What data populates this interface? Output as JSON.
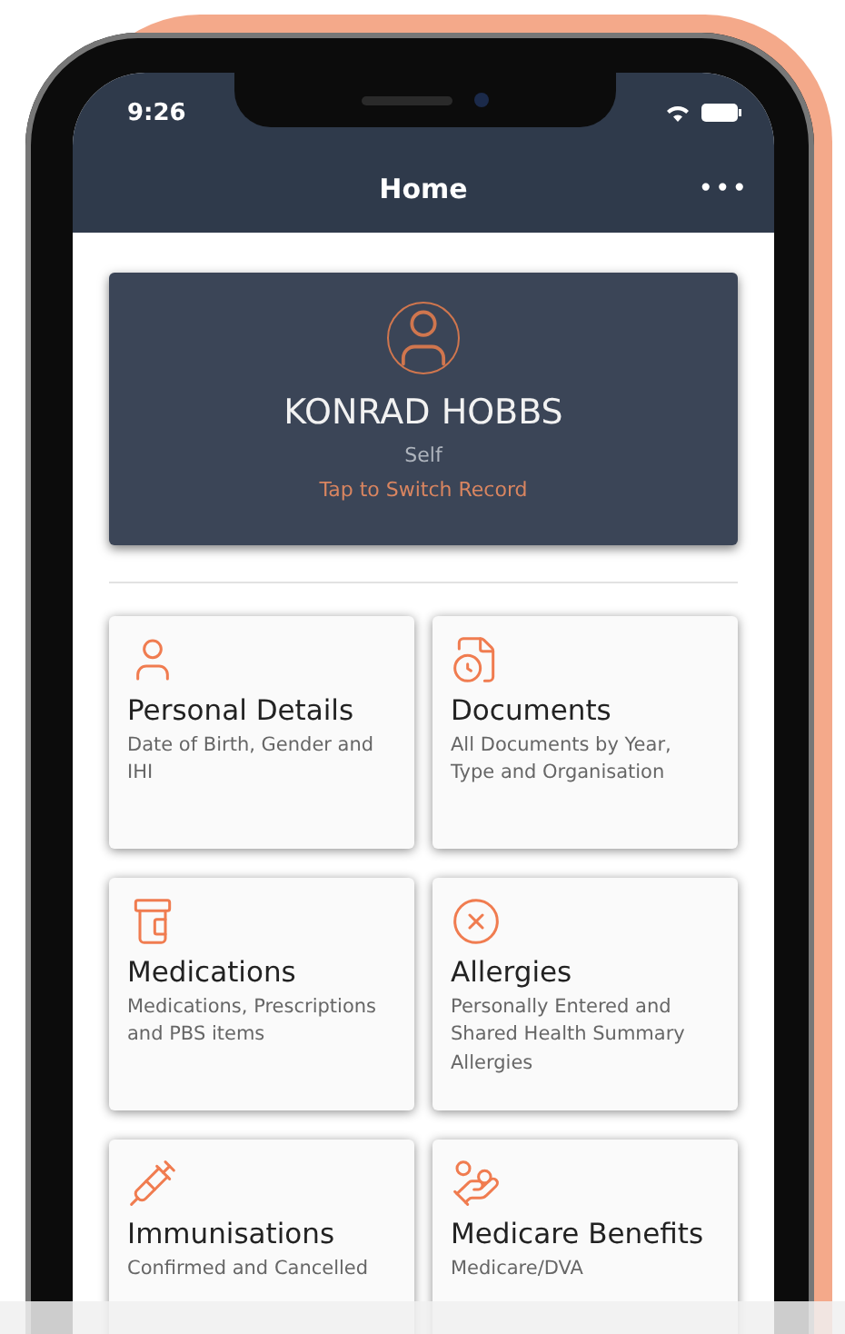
{
  "status_bar": {
    "time": "9:26"
  },
  "header": {
    "title": "Home",
    "menu": "•••"
  },
  "profile": {
    "name": "KONRAD HOBBS",
    "relation": "Self",
    "action": "Tap to Switch Record"
  },
  "cards": [
    {
      "title": "Personal Details",
      "description": "Date of Birth, Gender and IHI"
    },
    {
      "title": "Documents",
      "description": "All Documents by Year, Type and Organisation"
    },
    {
      "title": "Medications",
      "description": "Medications, Prescriptions and PBS items"
    },
    {
      "title": "Allergies",
      "description": "Personally Entered and Shared Health Summary Allergies"
    },
    {
      "title": "Immunisations",
      "description": "Confirmed and Cancelled"
    },
    {
      "title": "Medicare Benefits",
      "description": "Medicare/DVA"
    }
  ]
}
